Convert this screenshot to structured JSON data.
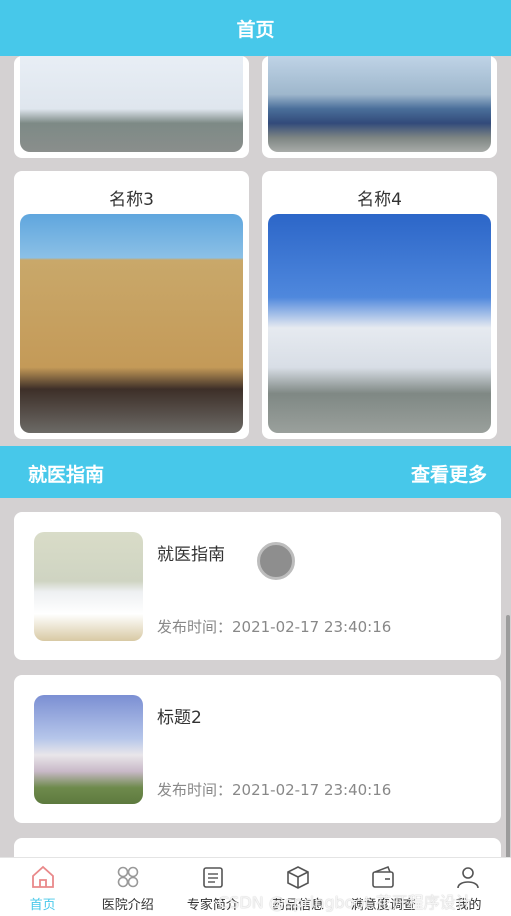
{
  "header": {
    "title": "首页"
  },
  "hospitals": [
    {
      "name": "名称3",
      "image": "hospital-tan-building-image"
    },
    {
      "name": "名称4",
      "image": "hospital-white-building-image"
    }
  ],
  "guide_section": {
    "title": "就医指南",
    "more_label": "查看更多"
  },
  "news": [
    {
      "title": "就医指南",
      "time": "发布时间：2021-02-17 23:40:16",
      "image": "ward-bed-image"
    },
    {
      "title": "标题2",
      "time": "发布时间：2021-02-17 23:40:16",
      "image": "hospital-complex-image"
    }
  ],
  "tabbar": {
    "items": [
      {
        "label": "首页",
        "icon": "home-icon",
        "active": true
      },
      {
        "label": "医院介绍",
        "icon": "grid-icon",
        "active": false
      },
      {
        "label": "专家简介",
        "icon": "doc-icon",
        "active": false
      },
      {
        "label": "药品信息",
        "icon": "box-icon",
        "active": false
      },
      {
        "label": "满意度调查",
        "icon": "wallet-icon",
        "active": false
      },
      {
        "label": "我的",
        "icon": "user-icon",
        "active": false
      }
    ]
  },
  "watermark": "CSDN @springboot 花开程序设计",
  "colors": {
    "accent": "#47c8ea",
    "background": "#d4d1d2"
  }
}
